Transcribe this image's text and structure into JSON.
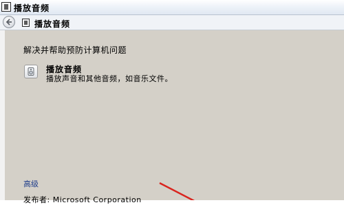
{
  "window": {
    "title": "播放音频"
  },
  "nav": {
    "title": "播放音频",
    "back_icon": "back-arrow-icon"
  },
  "content": {
    "heading": "解决并帮助预防计算机问题",
    "task": {
      "title": "播放音频",
      "description": "播放声音和其他音频，如音乐文件。",
      "icon": "audio-speaker-icon"
    },
    "advanced_link": "高级",
    "publisher": "发布者: Microsoft Corporation"
  },
  "colors": {
    "content_bg": "#d4d0c8",
    "link": "#1f3d8a",
    "annotation_arrow": "#d9241e"
  }
}
